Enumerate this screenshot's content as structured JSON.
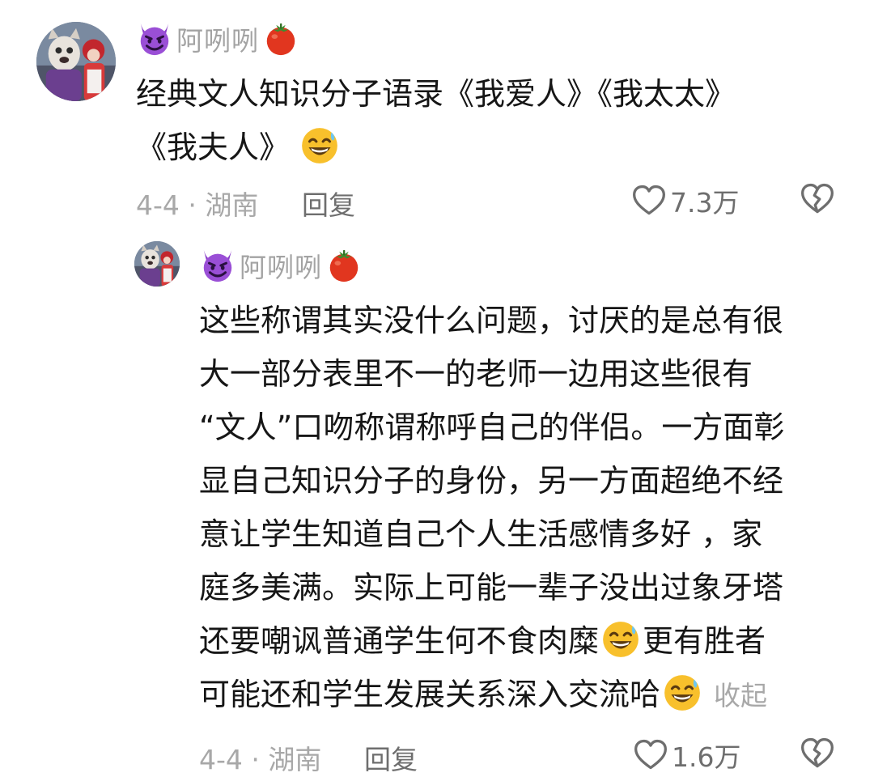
{
  "comments": [
    {
      "username": "阿咧咧",
      "lines": [
        "经典文人知识分子语录《我爱人》《我太太》",
        "《我夫人》"
      ],
      "date_location": "4-4 · 湖南",
      "reply_label": "回复",
      "like_count": "7.3万"
    }
  ],
  "reply": {
    "username": "阿咧咧",
    "lines": [
      "这些称谓其实没什么问题，讨厌的是总有很",
      "大一部分表里不一的老师一边用这些很有",
      "“文人”口吻称谓称呼自己的伴侣。一方面彰",
      "显自己知识分子的身份，另一方面超绝不经",
      "意让学生知道自己个人生活感情多好 ，家",
      "庭多美满。实际上可能一辈子没出过象牙塔",
      "还要嘲讽普通学生何不食肉糜",
      "更有胜者",
      "可能还和学生发展关系深入交流哈"
    ],
    "collapse_label": "收起",
    "date_location": "4-4 · 湖南",
    "reply_label": "回复",
    "like_count": "1.6万"
  },
  "icons": {
    "devil": "smiling-devil-emoji",
    "tomato": "tomato-emoji",
    "grin": "grinning-sweat-emoji",
    "like": "heart-outline-icon",
    "dislike": "broken-heart-icon"
  },
  "colors": {
    "text": "#161616",
    "muted": "#a8a8a8",
    "action": "#6e6e6e",
    "devil": "#9a4fd6",
    "tomato": "#e1361f",
    "emoji_face": "#f8c02c"
  }
}
